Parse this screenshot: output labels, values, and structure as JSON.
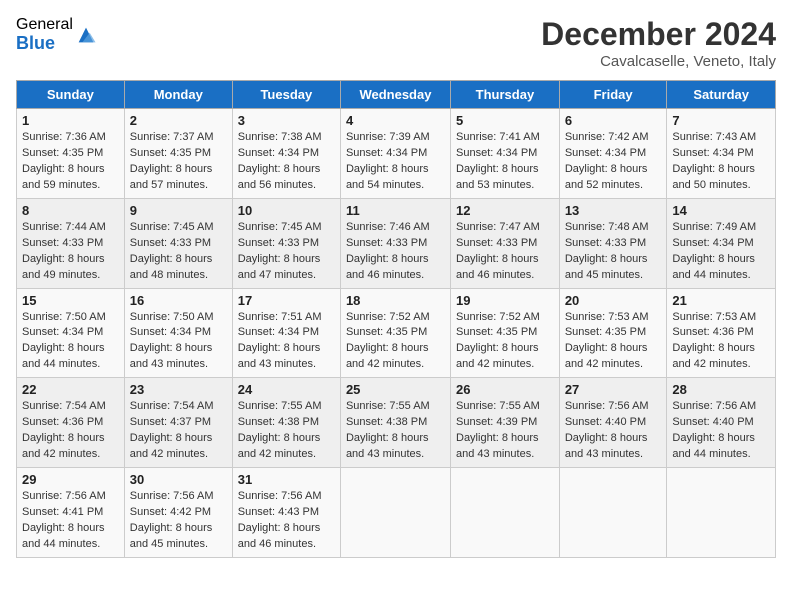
{
  "header": {
    "logo_general": "General",
    "logo_blue": "Blue",
    "month_title": "December 2024",
    "location": "Cavalcaselle, Veneto, Italy"
  },
  "weekdays": [
    "Sunday",
    "Monday",
    "Tuesday",
    "Wednesday",
    "Thursday",
    "Friday",
    "Saturday"
  ],
  "weeks": [
    [
      {
        "day": "1",
        "sunrise": "Sunrise: 7:36 AM",
        "sunset": "Sunset: 4:35 PM",
        "daylight": "Daylight: 8 hours and 59 minutes."
      },
      {
        "day": "2",
        "sunrise": "Sunrise: 7:37 AM",
        "sunset": "Sunset: 4:35 PM",
        "daylight": "Daylight: 8 hours and 57 minutes."
      },
      {
        "day": "3",
        "sunrise": "Sunrise: 7:38 AM",
        "sunset": "Sunset: 4:34 PM",
        "daylight": "Daylight: 8 hours and 56 minutes."
      },
      {
        "day": "4",
        "sunrise": "Sunrise: 7:39 AM",
        "sunset": "Sunset: 4:34 PM",
        "daylight": "Daylight: 8 hours and 54 minutes."
      },
      {
        "day": "5",
        "sunrise": "Sunrise: 7:41 AM",
        "sunset": "Sunset: 4:34 PM",
        "daylight": "Daylight: 8 hours and 53 minutes."
      },
      {
        "day": "6",
        "sunrise": "Sunrise: 7:42 AM",
        "sunset": "Sunset: 4:34 PM",
        "daylight": "Daylight: 8 hours and 52 minutes."
      },
      {
        "day": "7",
        "sunrise": "Sunrise: 7:43 AM",
        "sunset": "Sunset: 4:34 PM",
        "daylight": "Daylight: 8 hours and 50 minutes."
      }
    ],
    [
      {
        "day": "8",
        "sunrise": "Sunrise: 7:44 AM",
        "sunset": "Sunset: 4:33 PM",
        "daylight": "Daylight: 8 hours and 49 minutes."
      },
      {
        "day": "9",
        "sunrise": "Sunrise: 7:45 AM",
        "sunset": "Sunset: 4:33 PM",
        "daylight": "Daylight: 8 hours and 48 minutes."
      },
      {
        "day": "10",
        "sunrise": "Sunrise: 7:45 AM",
        "sunset": "Sunset: 4:33 PM",
        "daylight": "Daylight: 8 hours and 47 minutes."
      },
      {
        "day": "11",
        "sunrise": "Sunrise: 7:46 AM",
        "sunset": "Sunset: 4:33 PM",
        "daylight": "Daylight: 8 hours and 46 minutes."
      },
      {
        "day": "12",
        "sunrise": "Sunrise: 7:47 AM",
        "sunset": "Sunset: 4:33 PM",
        "daylight": "Daylight: 8 hours and 46 minutes."
      },
      {
        "day": "13",
        "sunrise": "Sunrise: 7:48 AM",
        "sunset": "Sunset: 4:33 PM",
        "daylight": "Daylight: 8 hours and 45 minutes."
      },
      {
        "day": "14",
        "sunrise": "Sunrise: 7:49 AM",
        "sunset": "Sunset: 4:34 PM",
        "daylight": "Daylight: 8 hours and 44 minutes."
      }
    ],
    [
      {
        "day": "15",
        "sunrise": "Sunrise: 7:50 AM",
        "sunset": "Sunset: 4:34 PM",
        "daylight": "Daylight: 8 hours and 44 minutes."
      },
      {
        "day": "16",
        "sunrise": "Sunrise: 7:50 AM",
        "sunset": "Sunset: 4:34 PM",
        "daylight": "Daylight: 8 hours and 43 minutes."
      },
      {
        "day": "17",
        "sunrise": "Sunrise: 7:51 AM",
        "sunset": "Sunset: 4:34 PM",
        "daylight": "Daylight: 8 hours and 43 minutes."
      },
      {
        "day": "18",
        "sunrise": "Sunrise: 7:52 AM",
        "sunset": "Sunset: 4:35 PM",
        "daylight": "Daylight: 8 hours and 42 minutes."
      },
      {
        "day": "19",
        "sunrise": "Sunrise: 7:52 AM",
        "sunset": "Sunset: 4:35 PM",
        "daylight": "Daylight: 8 hours and 42 minutes."
      },
      {
        "day": "20",
        "sunrise": "Sunrise: 7:53 AM",
        "sunset": "Sunset: 4:35 PM",
        "daylight": "Daylight: 8 hours and 42 minutes."
      },
      {
        "day": "21",
        "sunrise": "Sunrise: 7:53 AM",
        "sunset": "Sunset: 4:36 PM",
        "daylight": "Daylight: 8 hours and 42 minutes."
      }
    ],
    [
      {
        "day": "22",
        "sunrise": "Sunrise: 7:54 AM",
        "sunset": "Sunset: 4:36 PM",
        "daylight": "Daylight: 8 hours and 42 minutes."
      },
      {
        "day": "23",
        "sunrise": "Sunrise: 7:54 AM",
        "sunset": "Sunset: 4:37 PM",
        "daylight": "Daylight: 8 hours and 42 minutes."
      },
      {
        "day": "24",
        "sunrise": "Sunrise: 7:55 AM",
        "sunset": "Sunset: 4:38 PM",
        "daylight": "Daylight: 8 hours and 42 minutes."
      },
      {
        "day": "25",
        "sunrise": "Sunrise: 7:55 AM",
        "sunset": "Sunset: 4:38 PM",
        "daylight": "Daylight: 8 hours and 43 minutes."
      },
      {
        "day": "26",
        "sunrise": "Sunrise: 7:55 AM",
        "sunset": "Sunset: 4:39 PM",
        "daylight": "Daylight: 8 hours and 43 minutes."
      },
      {
        "day": "27",
        "sunrise": "Sunrise: 7:56 AM",
        "sunset": "Sunset: 4:40 PM",
        "daylight": "Daylight: 8 hours and 43 minutes."
      },
      {
        "day": "28",
        "sunrise": "Sunrise: 7:56 AM",
        "sunset": "Sunset: 4:40 PM",
        "daylight": "Daylight: 8 hours and 44 minutes."
      }
    ],
    [
      {
        "day": "29",
        "sunrise": "Sunrise: 7:56 AM",
        "sunset": "Sunset: 4:41 PM",
        "daylight": "Daylight: 8 hours and 44 minutes."
      },
      {
        "day": "30",
        "sunrise": "Sunrise: 7:56 AM",
        "sunset": "Sunset: 4:42 PM",
        "daylight": "Daylight: 8 hours and 45 minutes."
      },
      {
        "day": "31",
        "sunrise": "Sunrise: 7:56 AM",
        "sunset": "Sunset: 4:43 PM",
        "daylight": "Daylight: 8 hours and 46 minutes."
      },
      null,
      null,
      null,
      null
    ]
  ]
}
